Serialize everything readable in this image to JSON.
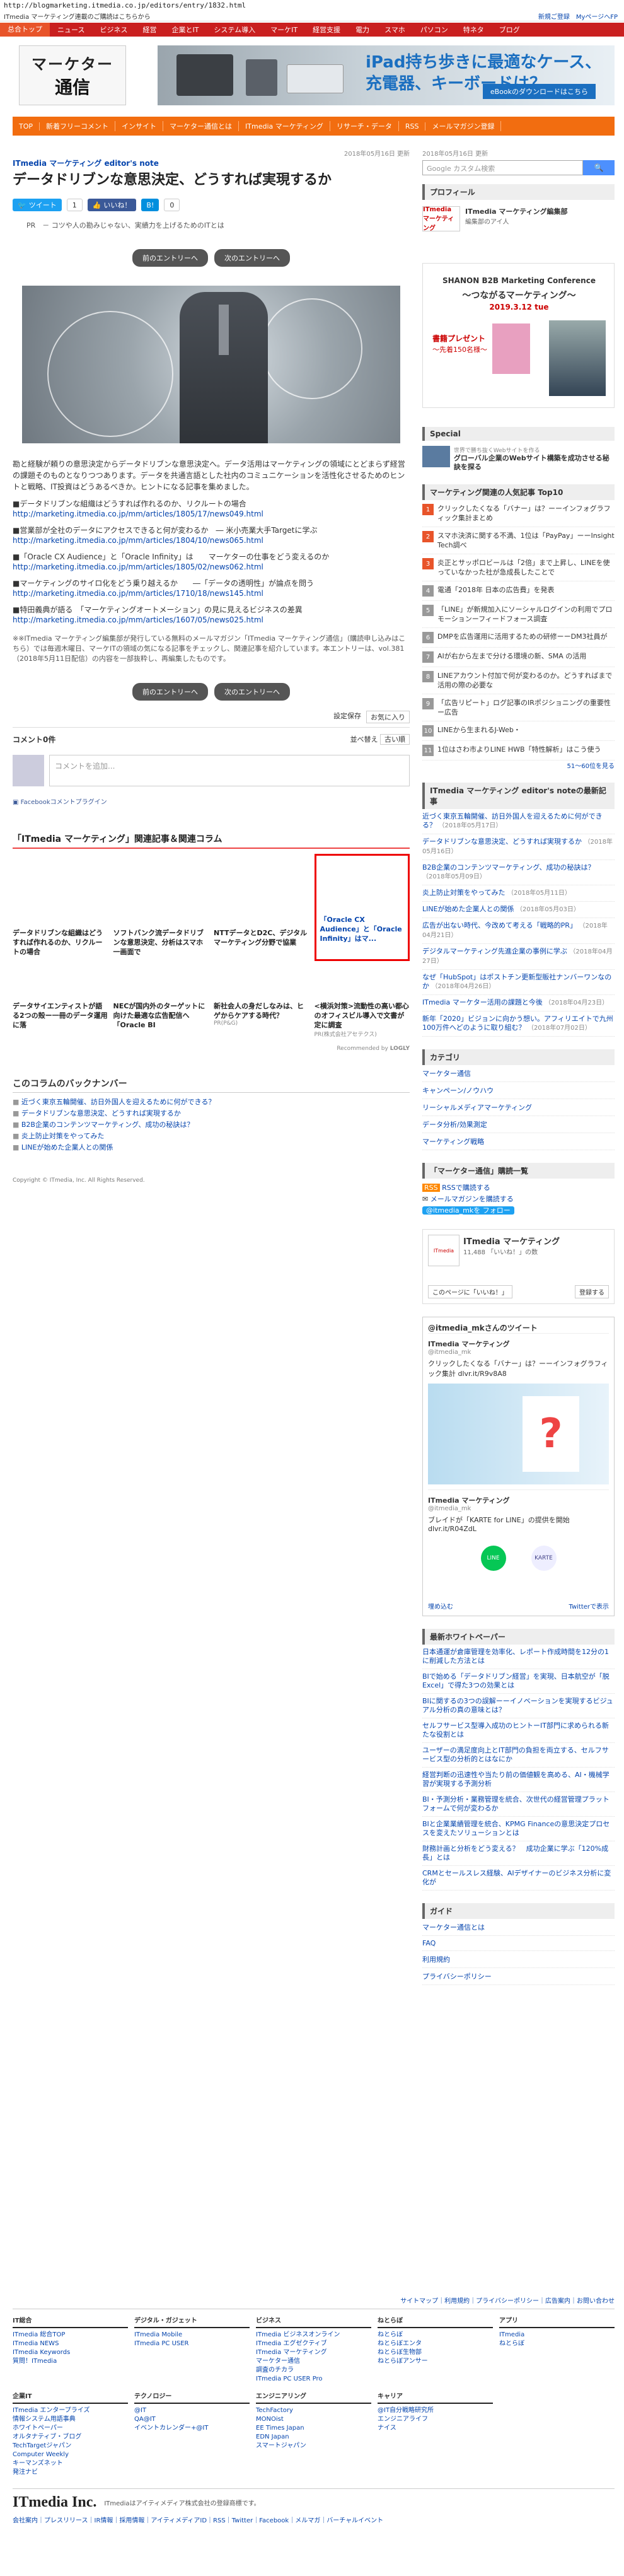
{
  "url": "http://blogmarketing.itmedia.co.jp/editors/entry/1832.html",
  "notice": {
    "text": "ITmedia マーケティング連載のご購読はこちらから",
    "right1": "新規ご登録",
    "right2": "MyページへFP"
  },
  "gnav": [
    "总合トップ",
    "ニュース",
    "ビジネス",
    "経営",
    "企業とIT",
    "システム導入",
    "マーケIT",
    "経営支援",
    "電力",
    "スマホ",
    "パソコン",
    "特ネタ",
    "ブログ"
  ],
  "logo": {
    "line1": "マーケター",
    "line2": "通信"
  },
  "banner": {
    "title1": "iPad持ち歩きに最適なケース、",
    "title2": "充電器、キーボードは？",
    "button": "eBookのダウンロードはこちら"
  },
  "snav": [
    "TOP",
    "新着フリーコメント",
    "インサイト",
    "マーケター通信とは",
    "ITmedia マーケティング",
    "リサーチ・データ",
    "RSS",
    "メールマガジン登録"
  ],
  "article": {
    "date": "2018年05月16日 更新",
    "category": "ITmedia マーケティング editor's note",
    "title": "データドリブンな意思決定、どうすれば実現するか",
    "share": {
      "tweet": "ツイート",
      "like": "いいね！",
      "hatena": "B!",
      "count1": "1",
      "count2": "0"
    },
    "lead": "コツや人の勘みじゃない、実績力を上げるためのITとは",
    "prev": "前のエントリーへ",
    "next": "次のエントリーへ",
    "body1": "勘と経験が頼りの意思決定からデータドリブンな意思決定へ。データ活用はマーケティングの領域にとどまらず経営の課題そのものとなりつつあります。データを共通言語とした社内のコミュニケーションを活性化させるためのヒントと戦略、IT投資はどうあるべきか。ヒントになる記事を集めました。",
    "links": [
      {
        "t": "■データドリブンな組織はどうすれば作れるのか、リクルートの場合",
        "u": "http://marketing.itmedia.co.jp/mm/articles/1805/17/news049.html"
      },
      {
        "t": "■営業部が全社のデータにアクセスできると何が変わるか　― 米小売業大手Targetに学ぶ",
        "u": "http://marketing.itmedia.co.jp/mm/articles/1804/10/news065.html"
      },
      {
        "t": "■「Oracle CX Audience」と「Oracle Infinity」は　　マーケターの仕事をどう変えるのか",
        "u": "http://marketing.itmedia.co.jp/mm/articles/1805/02/news062.html"
      },
      {
        "t": "■マーケティングのサイロ化をどう乗り越えるか　　―「データの透明性」が論点を問う",
        "u": "http://marketing.itmedia.co.jp/mm/articles/1710/18/news145.html"
      },
      {
        "t": "■特田義典が語る　「マーケティングオートメーション」の見に見えるビジネスの差異",
        "u": "http://marketing.itmedia.co.jp/mm/articles/1607/05/news025.html"
      }
    ],
    "footnote": "※※ITmedia マーケティング編集部が発行している無料のメールマガジン「ITmedia マーケティング通信」（購読申し込みはこちら）では毎週木曜日、マーケITの領域の気になる記事をチェックし、関連記事を紹介しています。本エントリーは、vol.381（2018年5月11日配信）の内容を一部抜粋し、再編集したものです。",
    "tagsave": "設定保存",
    "tagsave_btn": "お気に入り",
    "comment_count": "コメント0件",
    "sort": "並べ替え",
    "sort_value": "古い順",
    "comment_placeholder": "コメントを追加...",
    "fb_plugin": "Facebookコメントプラグイン"
  },
  "related": {
    "title": "「ITmedia マーケティング」関連記事＆関連コラム",
    "tiles": [
      {
        "cap": "データドリブンな組織はどうすれば作れるのか、リクルートの場合"
      },
      {
        "cap": "ソフトバンク流データドリブンな意思決定、分析はスマホ一画面で"
      },
      {
        "cap": "NTTデータとD2C、デジタルマーケティング分野で協業"
      },
      {
        "cap": "「Oracle CX Audience」と「Oracle Infinity」はマ..."
      },
      {
        "cap": "データサイエンティストが語る2つの殻ー一冊のデータ運用に落"
      },
      {
        "cap": "NECが国内外のターゲットに向けた最適な広告配信へ「Oracle BI"
      },
      {
        "cap": "新社会人の身だしなみは、ヒゲからケアする時代？",
        "sub": "PR(P&G)"
      },
      {
        "cap": "<横浜対策>流動性の高い都心のオフィスビル導入で文書が定に調査",
        "sub": "PR(株式会社アセテクス)"
      }
    ],
    "recommend": "Recommended by",
    "logly": "LOGLY"
  },
  "backnumber": {
    "title": "このコラムのバックナンバー",
    "items": [
      "近づく東京五輪開催、訪日外国人を迎えるために何ができる？",
      "データドリブンな意思決定、どうすれば実現するか",
      "B2B企業のコンテンツマーケティング、成功の秘訣は？",
      "炎上防止対策をやってみた",
      "LINEが始めた企業人との関係"
    ]
  },
  "copyright": "Copyright © ITmedia, Inc. All Rights Reserved.",
  "sidebar": {
    "date": "2018年05月16日 更新",
    "search_placeholder": "Google カスタム検索",
    "search_btn": "検索",
    "profile_title": "プロフィール",
    "profile_name": "ITmedia マーケティング編集部",
    "profile_sub": "編集部のアイ人",
    "profile_logo": "ITmedia マーケティング",
    "ad": {
      "line1": "SHANON B2B Marketing Conference",
      "line2": "〜つながるマーケティング〜",
      "line3": "2019.3.12 tue",
      "line4": "書籍プレゼント",
      "line5": "〜先着150名様〜"
    },
    "special_title": "Special",
    "special_text": "グローバル企業のWebサイト構築を成功させる秘訣を探る",
    "special_sub": "世界で勝ち抜くWebサイトを作る",
    "ranking_title": "マーケティング関連の人気記事 Top10",
    "ranking": [
      "クリックしたくなる「バナー」は？ーーインフォグラフィック集計まとめ",
      "スマホ決済に関する不満、1位は「PayPay」ーーInsight Tech調べ",
      "炎正とサッポロビールは「2倍」まで上昇し、LINEを使っていなかった社が急成長したことで",
      "電通「2018年 日本の広告費」を発表",
      "「LINE」が新規加入にソーシャルログインの利用でプロモーションーフィードフォース調査",
      "DMPを広告運用に活用するための研修ーーDM3社員が",
      "AIが右から左まで分ける環境の新、SMA の活用",
      "LINEアカウント付加で何が変わるのか。どうすればまで活用の際の必要な",
      "「広告リピート」ログ記事のIRポジショニングの重要性ー広告",
      "LINEから生まれるJ-Web・",
      "1位はさわ市よりLINE HWB「特性解析」はこう使う"
    ],
    "ranking_more": "51～60位を見る",
    "note_title": "ITmedia マーケティング editor's noteの最新記事",
    "notes": [
      {
        "t": "近づく東京五輪開催、訪日外国人を迎えるために何ができる？",
        "d": "（2018年05月17日）"
      },
      {
        "t": "データドリブンな意思決定、どうすれば実現するか",
        "d": "（2018年05月16日）"
      },
      {
        "t": "B2B企業のコンテンツマーケティング、成功の秘訣は？",
        "d": "（2018年05月09日）"
      },
      {
        "t": "炎上防止対策をやってみた",
        "d": "（2018年05月11日）"
      },
      {
        "t": "LINEが始めた企業人との関係",
        "d": "（2018年05月03日）"
      },
      {
        "t": "広告が出ない時代、今改めて考える「戦略的PR」",
        "d": "（2018年04月21日）"
      },
      {
        "t": "デジタルマーケティング先進企業の事例に学ぶ",
        "d": "（2018年04月27日）"
      },
      {
        "t": "なぜ「HubSpot」はポストチン更新型販社ナンバーワンなのか",
        "d": "（2018年04月26日）"
      },
      {
        "t": "ITmedia マーケター活用の課題と今後",
        "d": "（2018年04月23日）"
      },
      {
        "t": "新年「2020」ビジョンに向かう想い。アフィリエイトで九州100万件へどのように取り組む？",
        "d": "（2018年07月02日）"
      }
    ],
    "cat_title": "カテゴリ",
    "cats": [
      "マーケター通信",
      "キャンペーン/ノウハウ",
      "リーシャルメディアマーケティング",
      "データ分析/効果測定",
      "マーケティング戦略"
    ],
    "sub_title": "「マーケター通信」購読一覧",
    "rss": "RSSで購読する",
    "mail": "メールマガジンを購読する",
    "follow": "@itmedia_mkを フォロー",
    "fb_page": "ITmedia マーケティング",
    "fb_likes": "11,488 「いいね！」の数",
    "fb_like_btn": "このページに「いいね！」",
    "fb_reg": "登録する",
    "tw_head": "@itmedia_mkさんのツイート",
    "tw_name": "ITmedia マーケティング",
    "tw_handle": "@itmedia_mk",
    "tw_text1": "クリックしたくなる「バナー」は？ーーインフォグラフィック集計 dlvr.it/R9v8A8",
    "tw_text2": "ブレイドが「KARTE for LINE」の提供を開始 dlvr.it/R04ZdL",
    "tw_embed": "埋め込む",
    "tw_view": "Twitterで表示",
    "wp_title": "最新ホワイトペーパー",
    "wp": [
      "日本通運が倉庫管理を効率化、レポート作成時間を12分の1に削減した方法とは",
      "BIで始める「データドリブン経営」を実現、日本航空が「脱Excel」で得た3つの効果とは",
      "BIに関するの3つの誤解ーーイノベーションを実現するビジュアル分析の真の意味とは？",
      "セルフサービス型導入成功のヒントーIT部門に求められる新たな役割とは",
      "ユーザーの満足度向上とIT部門の負担を両立する、セルフサービス型の分析的とはなにか",
      "経営判断の迅速性や当たり前の価値観を高める、AI・機械学習が実現する予測分析",
      "BI・予測分析・業務管理を統合、次世代の経営管理プラットフォームで何が変わるか",
      "BIと企業業績管理を統合、KPMG Financeの意思決定プロセスを変えたソリューションとは",
      "財務計画と分析をどう変える？　成功企業に学ぶ「120%成長」とは",
      "CRMとセールスレス経験、AIデザイナーのビジネス分析に変化が"
    ],
    "guide_title": "ガイド",
    "guide": [
      "マーケター通信とは",
      "FAQ",
      "利用規約",
      "プライバシーポリシー"
    ]
  },
  "footer": {
    "sitemap": "サイトマップ｜利用規約｜プライバシーポリシー｜広告案内｜お問い合わせ",
    "cols": [
      {
        "h": "IT総合",
        "items": [
          "ITmedia 総合TOP",
          "ITmedia NEWS",
          "ITmedia Keywords",
          "質問！ITmedia"
        ]
      },
      {
        "h": "デジタル・ガジェット",
        "items": [
          "ITmedia Mobile",
          "ITmedia PC USER"
        ]
      },
      {
        "h": "ビジネス",
        "items": [
          "ITmedia ビジネスオンライン",
          "ITmedia エグゼクティブ",
          "ITmedia マーケティング",
          "マーケター通信",
          "調査のチカラ",
          "ITmedia PC USER Pro"
        ]
      },
      {
        "h": "ねとらぼ",
        "items": [
          "ねとらぼ",
          "ねとらぼエンタ",
          "ねとらぼ生物部",
          "ねとらぼアンサー"
        ]
      },
      {
        "h": "アプリ",
        "items": [
          "ITmedia",
          "ねとらぼ"
        ]
      },
      {
        "h": "企業IT",
        "items": [
          "ITmedia エンタープライズ",
          "情報システム用語事典",
          "ホワイトペーパー",
          "オルタナティブ・ブログ",
          "TechTargetジャパン",
          "Computer Weekly",
          "キーマンズネット",
          "発注ナビ"
        ]
      },
      {
        "h": "テクノロジー",
        "items": [
          "@IT",
          "QA@IT",
          "イベントカレンダー+@IT"
        ]
      },
      {
        "h": "エンジニアリング",
        "items": [
          "TechFactory",
          "MONOist",
          "EE Times Japan",
          "EDN Japan",
          "スマートジャパン"
        ]
      },
      {
        "h": "キャリア",
        "items": [
          "@IT自分戦略研究所",
          "エンジニアライフ",
          "ナイス"
        ]
      }
    ],
    "corp": "ITmedia Inc.",
    "corp_note": "ITmediaはアイティメディア株式会社の登録商標です。",
    "links": "会社案内｜プレスリリース｜IR情報｜採用情報｜アイティメディアID｜RSS｜Twitter｜Facebook｜メルマガ｜バーチャルイベント"
  }
}
